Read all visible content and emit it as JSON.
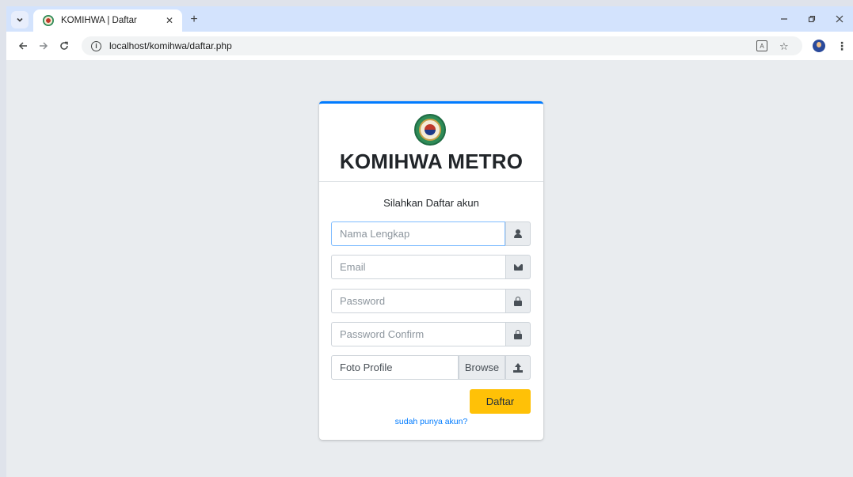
{
  "browser": {
    "tab_title": "KOMIHWA | Daftar",
    "tab_close": "✕",
    "new_tab": "+",
    "url": "localhost/komihwa/daftar.php",
    "icons": [
      "chevron-down-icon",
      "favicon-icon",
      "close-icon",
      "plus-icon",
      "minimize-icon",
      "restore-icon",
      "close-window-icon",
      "back-icon",
      "forward-icon",
      "reload-icon",
      "info-icon",
      "translate-icon",
      "star-icon",
      "avatar",
      "kebab-menu-icon"
    ]
  },
  "card": {
    "brand": "KOMIHWA METRO",
    "subtitle": "Silahkan Daftar akun",
    "accent_color": "#007bff"
  },
  "form": {
    "nama_placeholder": "Nama Lengkap",
    "email_placeholder": "Email",
    "password_placeholder": "Password",
    "password_confirm_placeholder": "Password Confirm",
    "foto_label": "Foto Profile",
    "browse_label": "Browse",
    "submit_label": "Daftar",
    "submit_color": "#ffc107",
    "login_link": "sudah punya akun?"
  }
}
